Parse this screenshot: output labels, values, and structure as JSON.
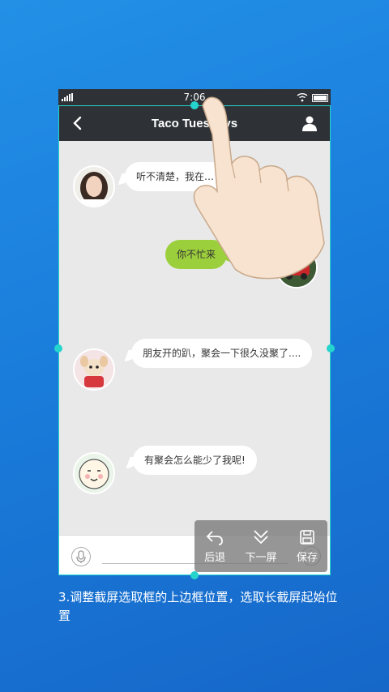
{
  "status_bar": {
    "time": "7:06"
  },
  "nav": {
    "title": "Taco Tuesdays"
  },
  "messages": [
    {
      "side": "left",
      "text": "听不清楚，我在…",
      "avatar": "woman-avatar"
    },
    {
      "side": "right",
      "text": "你不忙来",
      "avatar": "red-car-avatar"
    },
    {
      "side": "left",
      "text": "朋友开的趴，聚会一下很久没聚了....",
      "avatar": "puppy-avatar"
    },
    {
      "side": "left",
      "text": "有聚会怎么能少了我呢!",
      "avatar": "cartoon-avatar"
    }
  ],
  "toolbar": {
    "back_label": "后退",
    "next_screen_label": "下一屏",
    "save_label": "保存"
  },
  "input": {
    "plus": "+"
  },
  "caption": "3.调整截屏选取框的上边框位置，选取长截屏起始位置",
  "colors": {
    "background": "#1a7ddb",
    "bar": "#2e3236",
    "selection_frame": "#25d4cc",
    "sent_bubble": "#9ccf3c"
  }
}
